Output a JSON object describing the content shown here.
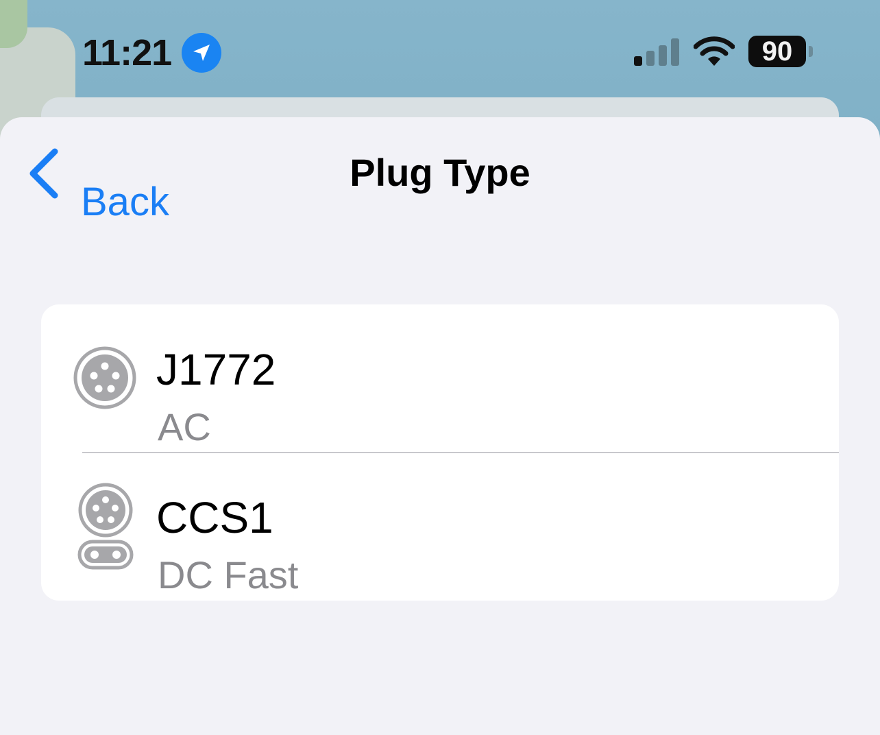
{
  "status_bar": {
    "time": "11:21",
    "battery": "90",
    "icons": [
      "location-arrow-icon",
      "cellular-signal-icon",
      "wifi-icon",
      "battery-icon"
    ]
  },
  "nav": {
    "back_label": "Back",
    "title": "Plug Type"
  },
  "plug_types": [
    {
      "name": "J1772",
      "type": "AC",
      "icon": "j1772-plug-icon"
    },
    {
      "name": "CCS1",
      "type": "DC Fast",
      "icon": "ccs1-plug-icon"
    }
  ],
  "colors": {
    "accent": "#1a7ef5",
    "secondary_text": "#8a8a8e",
    "sheet_background": "#f2f2f7",
    "location_badge": "#1a84f2"
  }
}
